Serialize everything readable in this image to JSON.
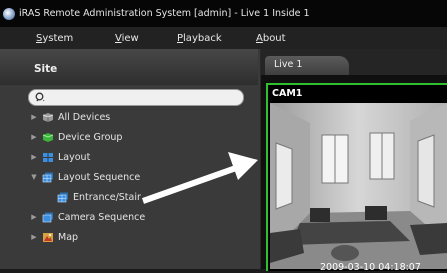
{
  "window": {
    "title": "iRAS Remote Administration System [admin] - Live 1  Inside 1"
  },
  "menu": {
    "items": [
      {
        "label": "System",
        "underline": "S",
        "rest": "ystem"
      },
      {
        "label": "View",
        "underline": "V",
        "rest": "iew"
      },
      {
        "label": "Playback",
        "underline": "P",
        "rest": "layback"
      },
      {
        "label": "About",
        "underline": "A",
        "rest": "bout"
      }
    ]
  },
  "sidebar": {
    "title": "Site",
    "search": {
      "placeholder": "",
      "value": ""
    },
    "tree": [
      {
        "label": "All Devices",
        "icon": "devices-icon",
        "expanded": false
      },
      {
        "label": "Device Group",
        "icon": "device-group-icon",
        "expanded": false
      },
      {
        "label": "Layout",
        "icon": "layout-icon",
        "expanded": false
      },
      {
        "label": "Layout Sequence",
        "icon": "layout-sequence-icon",
        "expanded": true
      },
      {
        "label": "Entrance/Stair",
        "icon": "layout-sequence-item-icon",
        "child": true
      },
      {
        "label": "Camera Sequence",
        "icon": "camera-sequence-icon",
        "expanded": false
      },
      {
        "label": "Map",
        "icon": "map-icon",
        "expanded": false
      }
    ]
  },
  "main": {
    "tab": "Live  1",
    "camera": {
      "label": "CAM1",
      "timestamp": "2009-03-10 04:18:07"
    }
  },
  "colors": {
    "active_border": "#2fbf2f",
    "pointer_arrow": "#ffffff"
  }
}
